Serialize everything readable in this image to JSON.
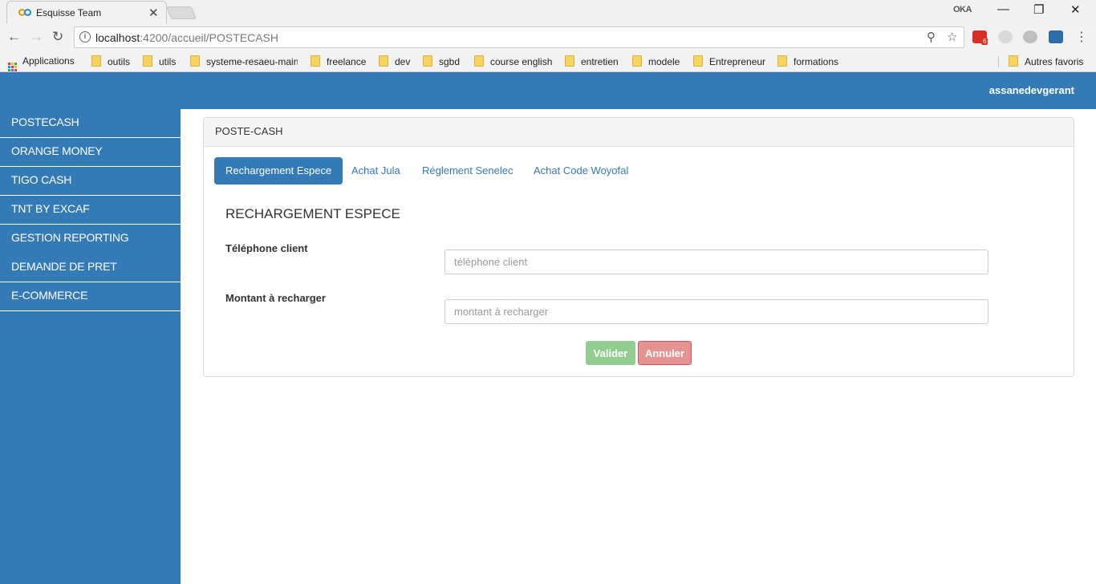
{
  "browser": {
    "tab_title": "Esquisse Team",
    "tab_close": "✕",
    "profile_badge": "OKA",
    "url_host": "localhost",
    "url_path": ":4200/accueil/POSTECASH",
    "window_controls": {
      "minimize": "—",
      "restore": "❐",
      "close": "✕"
    },
    "ext_badge": "6",
    "bookmarks": [
      "Applications",
      "outils",
      "utils",
      "systeme-resaeu-main",
      "freelance",
      "dev",
      "sgbd",
      "course english",
      "entretien",
      "modele",
      "Entrepreneur",
      "formations"
    ],
    "other_bookmarks": "Autres favoris",
    "icons": [
      "back-arrow-icon",
      "forward-arrow-icon",
      "reload-icon",
      "info-icon",
      "zoom-icon",
      "star-icon",
      "gmail-icon",
      "skype-icon"
    ]
  },
  "header": {
    "username": "assanedevgerant"
  },
  "sidebar": {
    "items": [
      {
        "label": "POSTECASH"
      },
      {
        "label": "ORANGE MONEY"
      },
      {
        "label": "TIGO CASH"
      },
      {
        "label": "TNT BY EXCAF"
      },
      {
        "label": "GESTION REPORTING"
      },
      {
        "label": "DEMANDE DE PRET"
      },
      {
        "label": "E-COMMERCE"
      }
    ]
  },
  "panel": {
    "heading": "POSTE-CASH",
    "tabs": [
      {
        "label": "Rechargement Espece",
        "active": true
      },
      {
        "label": "Achat Jula"
      },
      {
        "label": "Réglement Senelec"
      },
      {
        "label": "Achat Code Woyofal"
      }
    ],
    "form": {
      "title": "RECHARGEMENT ESPECE",
      "phone_label": "Téléphone client",
      "phone_placeholder": "téléphone client",
      "amount_label": "Montant à recharger",
      "amount_placeholder": "montant à recharger",
      "submit_label": "Valider",
      "cancel_label": "Annuler"
    }
  },
  "colors": {
    "primary": "#337ab7",
    "success_disabled": "#91cd91",
    "danger_disabled": "#e59390"
  }
}
